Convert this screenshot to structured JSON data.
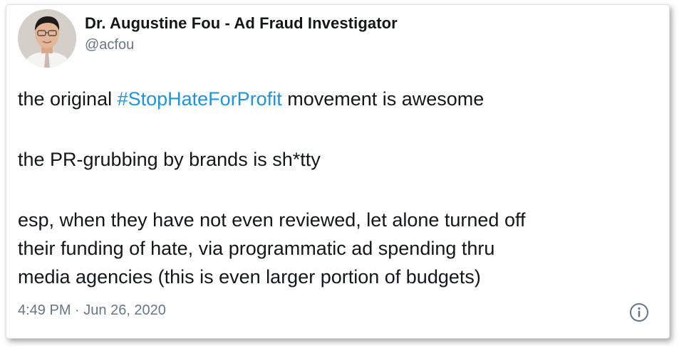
{
  "tweet": {
    "author": {
      "display_name": "Dr. Augustine Fou - Ad Fraud Investigator",
      "handle": "@acfou",
      "avatar_icon": "profile-photo"
    },
    "text": {
      "line1_prefix": "the original ",
      "line1_hashtag": "#StopHateForProfit",
      "line1_suffix": " movement is awesome",
      "line2": "the PR-grubbing by brands is sh*tty",
      "line3_a": "esp, when they have not even reviewed, let alone turned off",
      "line3_b": "their funding of hate, via programmatic ad spending thru",
      "line3_c": "media agencies (this is even larger portion of budgets)"
    },
    "meta": {
      "time": "4:49 PM",
      "separator": " · ",
      "date": "Jun 26, 2020"
    },
    "info_icon": "info-icon"
  },
  "colors": {
    "hashtag": "#1b95e0",
    "text": "#14171a",
    "muted": "#657786"
  }
}
